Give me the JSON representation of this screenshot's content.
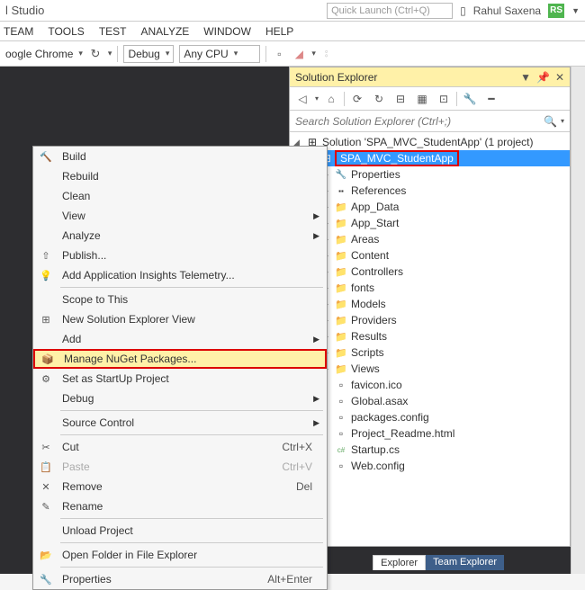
{
  "title": "l Studio",
  "quick_launch_placeholder": "Quick Launch (Ctrl+Q)",
  "user": {
    "name": "Rahul Saxena",
    "initials": "RS"
  },
  "menu": [
    "TEAM",
    "TOOLS",
    "TEST",
    "ANALYZE",
    "WINDOW",
    "HELP"
  ],
  "toolbar": {
    "browser": "oogle Chrome",
    "config": "Debug",
    "platform": "Any CPU"
  },
  "solution_explorer": {
    "title": "Solution Explorer",
    "search_placeholder": "Search Solution Explorer (Ctrl+;)",
    "solution_label": "Solution 'SPA_MVC_StudentApp' (1 project)",
    "project_name": "SPA_MVC_StudentApp",
    "nodes": [
      {
        "label": "Properties",
        "icon": "wrench"
      },
      {
        "label": "References",
        "icon": "refs"
      },
      {
        "label": "App_Data",
        "icon": "folder"
      },
      {
        "label": "App_Start",
        "icon": "folder"
      },
      {
        "label": "Areas",
        "icon": "folder"
      },
      {
        "label": "Content",
        "icon": "folder"
      },
      {
        "label": "Controllers",
        "icon": "folder"
      },
      {
        "label": "fonts",
        "icon": "folder"
      },
      {
        "label": "Models",
        "icon": "folder"
      },
      {
        "label": "Providers",
        "icon": "folder"
      },
      {
        "label": "Results",
        "icon": "folder"
      },
      {
        "label": "Scripts",
        "icon": "folder"
      },
      {
        "label": "Views",
        "icon": "folder"
      },
      {
        "label": "favicon.ico",
        "icon": "file"
      },
      {
        "label": "Global.asax",
        "icon": "file"
      },
      {
        "label": "packages.config",
        "icon": "file"
      },
      {
        "label": "Project_Readme.html",
        "icon": "file"
      },
      {
        "label": "Startup.cs",
        "icon": "cs"
      },
      {
        "label": "Web.config",
        "icon": "file"
      }
    ],
    "tabs": [
      {
        "label": "Explorer",
        "active": false
      },
      {
        "label": "Team Explorer",
        "active": true
      }
    ]
  },
  "context_menu": [
    {
      "label": "Build",
      "icon": "build"
    },
    {
      "label": "Rebuild"
    },
    {
      "label": "Clean"
    },
    {
      "label": "View",
      "submenu": true
    },
    {
      "label": "Analyze",
      "submenu": true
    },
    {
      "label": "Publish...",
      "icon": "publish"
    },
    {
      "label": "Add Application Insights Telemetry...",
      "icon": "insights"
    },
    {
      "sep": true
    },
    {
      "label": "Scope to This"
    },
    {
      "label": "New Solution Explorer View",
      "icon": "newview"
    },
    {
      "label": "Add",
      "submenu": true
    },
    {
      "label": "Manage NuGet Packages...",
      "icon": "nuget",
      "highlight": true
    },
    {
      "label": "Set as StartUp Project",
      "icon": "gear"
    },
    {
      "label": "Debug",
      "submenu": true
    },
    {
      "sep": true
    },
    {
      "label": "Source Control",
      "submenu": true
    },
    {
      "sep": true
    },
    {
      "label": "Cut",
      "icon": "cut",
      "shortcut": "Ctrl+X"
    },
    {
      "label": "Paste",
      "icon": "paste",
      "shortcut": "Ctrl+V",
      "disabled": true
    },
    {
      "label": "Remove",
      "icon": "remove",
      "shortcut": "Del"
    },
    {
      "label": "Rename",
      "icon": "rename"
    },
    {
      "sep": true
    },
    {
      "label": "Unload Project"
    },
    {
      "sep": true
    },
    {
      "label": "Open Folder in File Explorer",
      "icon": "folder"
    },
    {
      "sep": true
    },
    {
      "label": "Properties",
      "icon": "wrench",
      "shortcut": "Alt+Enter"
    }
  ]
}
